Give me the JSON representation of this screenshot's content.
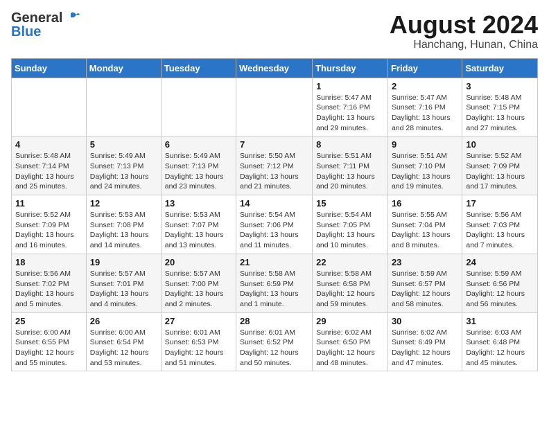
{
  "header": {
    "logo_general": "General",
    "logo_blue": "Blue",
    "title": "August 2024",
    "subtitle": "Hanchang, Hunan, China"
  },
  "calendar": {
    "days_of_week": [
      "Sunday",
      "Monday",
      "Tuesday",
      "Wednesday",
      "Thursday",
      "Friday",
      "Saturday"
    ],
    "weeks": [
      [
        {
          "day": "",
          "info": ""
        },
        {
          "day": "",
          "info": ""
        },
        {
          "day": "",
          "info": ""
        },
        {
          "day": "",
          "info": ""
        },
        {
          "day": "1",
          "info": "Sunrise: 5:47 AM\nSunset: 7:16 PM\nDaylight: 13 hours\nand 29 minutes."
        },
        {
          "day": "2",
          "info": "Sunrise: 5:47 AM\nSunset: 7:16 PM\nDaylight: 13 hours\nand 28 minutes."
        },
        {
          "day": "3",
          "info": "Sunrise: 5:48 AM\nSunset: 7:15 PM\nDaylight: 13 hours\nand 27 minutes."
        }
      ],
      [
        {
          "day": "4",
          "info": "Sunrise: 5:48 AM\nSunset: 7:14 PM\nDaylight: 13 hours\nand 25 minutes."
        },
        {
          "day": "5",
          "info": "Sunrise: 5:49 AM\nSunset: 7:13 PM\nDaylight: 13 hours\nand 24 minutes."
        },
        {
          "day": "6",
          "info": "Sunrise: 5:49 AM\nSunset: 7:13 PM\nDaylight: 13 hours\nand 23 minutes."
        },
        {
          "day": "7",
          "info": "Sunrise: 5:50 AM\nSunset: 7:12 PM\nDaylight: 13 hours\nand 21 minutes."
        },
        {
          "day": "8",
          "info": "Sunrise: 5:51 AM\nSunset: 7:11 PM\nDaylight: 13 hours\nand 20 minutes."
        },
        {
          "day": "9",
          "info": "Sunrise: 5:51 AM\nSunset: 7:10 PM\nDaylight: 13 hours\nand 19 minutes."
        },
        {
          "day": "10",
          "info": "Sunrise: 5:52 AM\nSunset: 7:09 PM\nDaylight: 13 hours\nand 17 minutes."
        }
      ],
      [
        {
          "day": "11",
          "info": "Sunrise: 5:52 AM\nSunset: 7:09 PM\nDaylight: 13 hours\nand 16 minutes."
        },
        {
          "day": "12",
          "info": "Sunrise: 5:53 AM\nSunset: 7:08 PM\nDaylight: 13 hours\nand 14 minutes."
        },
        {
          "day": "13",
          "info": "Sunrise: 5:53 AM\nSunset: 7:07 PM\nDaylight: 13 hours\nand 13 minutes."
        },
        {
          "day": "14",
          "info": "Sunrise: 5:54 AM\nSunset: 7:06 PM\nDaylight: 13 hours\nand 11 minutes."
        },
        {
          "day": "15",
          "info": "Sunrise: 5:54 AM\nSunset: 7:05 PM\nDaylight: 13 hours\nand 10 minutes."
        },
        {
          "day": "16",
          "info": "Sunrise: 5:55 AM\nSunset: 7:04 PM\nDaylight: 13 hours\nand 8 minutes."
        },
        {
          "day": "17",
          "info": "Sunrise: 5:56 AM\nSunset: 7:03 PM\nDaylight: 13 hours\nand 7 minutes."
        }
      ],
      [
        {
          "day": "18",
          "info": "Sunrise: 5:56 AM\nSunset: 7:02 PM\nDaylight: 13 hours\nand 5 minutes."
        },
        {
          "day": "19",
          "info": "Sunrise: 5:57 AM\nSunset: 7:01 PM\nDaylight: 13 hours\nand 4 minutes."
        },
        {
          "day": "20",
          "info": "Sunrise: 5:57 AM\nSunset: 7:00 PM\nDaylight: 13 hours\nand 2 minutes."
        },
        {
          "day": "21",
          "info": "Sunrise: 5:58 AM\nSunset: 6:59 PM\nDaylight: 13 hours\nand 1 minute."
        },
        {
          "day": "22",
          "info": "Sunrise: 5:58 AM\nSunset: 6:58 PM\nDaylight: 12 hours\nand 59 minutes."
        },
        {
          "day": "23",
          "info": "Sunrise: 5:59 AM\nSunset: 6:57 PM\nDaylight: 12 hours\nand 58 minutes."
        },
        {
          "day": "24",
          "info": "Sunrise: 5:59 AM\nSunset: 6:56 PM\nDaylight: 12 hours\nand 56 minutes."
        }
      ],
      [
        {
          "day": "25",
          "info": "Sunrise: 6:00 AM\nSunset: 6:55 PM\nDaylight: 12 hours\nand 55 minutes."
        },
        {
          "day": "26",
          "info": "Sunrise: 6:00 AM\nSunset: 6:54 PM\nDaylight: 12 hours\nand 53 minutes."
        },
        {
          "day": "27",
          "info": "Sunrise: 6:01 AM\nSunset: 6:53 PM\nDaylight: 12 hours\nand 51 minutes."
        },
        {
          "day": "28",
          "info": "Sunrise: 6:01 AM\nSunset: 6:52 PM\nDaylight: 12 hours\nand 50 minutes."
        },
        {
          "day": "29",
          "info": "Sunrise: 6:02 AM\nSunset: 6:50 PM\nDaylight: 12 hours\nand 48 minutes."
        },
        {
          "day": "30",
          "info": "Sunrise: 6:02 AM\nSunset: 6:49 PM\nDaylight: 12 hours\nand 47 minutes."
        },
        {
          "day": "31",
          "info": "Sunrise: 6:03 AM\nSunset: 6:48 PM\nDaylight: 12 hours\nand 45 minutes."
        }
      ]
    ]
  }
}
